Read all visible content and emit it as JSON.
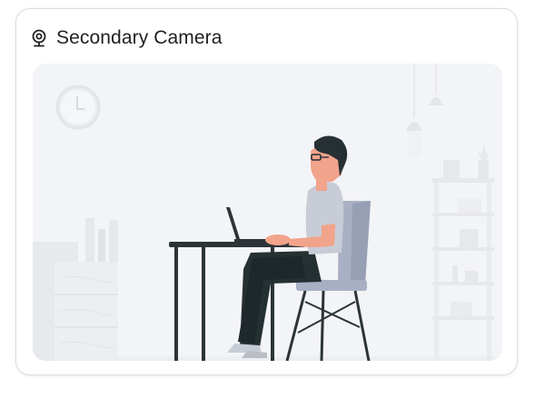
{
  "card": {
    "title": "Secondary Camera",
    "icon": "webcam-icon"
  },
  "scene": {
    "description_icon": "person-at-desk-illustration"
  },
  "colors": {
    "card_border": "#dcdde3",
    "title_text": "#1f2024",
    "scene_bg": "#f3f4f7",
    "accent_chair": "#a9b0c4",
    "shirt": "#c8ccd6",
    "pants": "#253033",
    "skin": "#f2a38b"
  }
}
